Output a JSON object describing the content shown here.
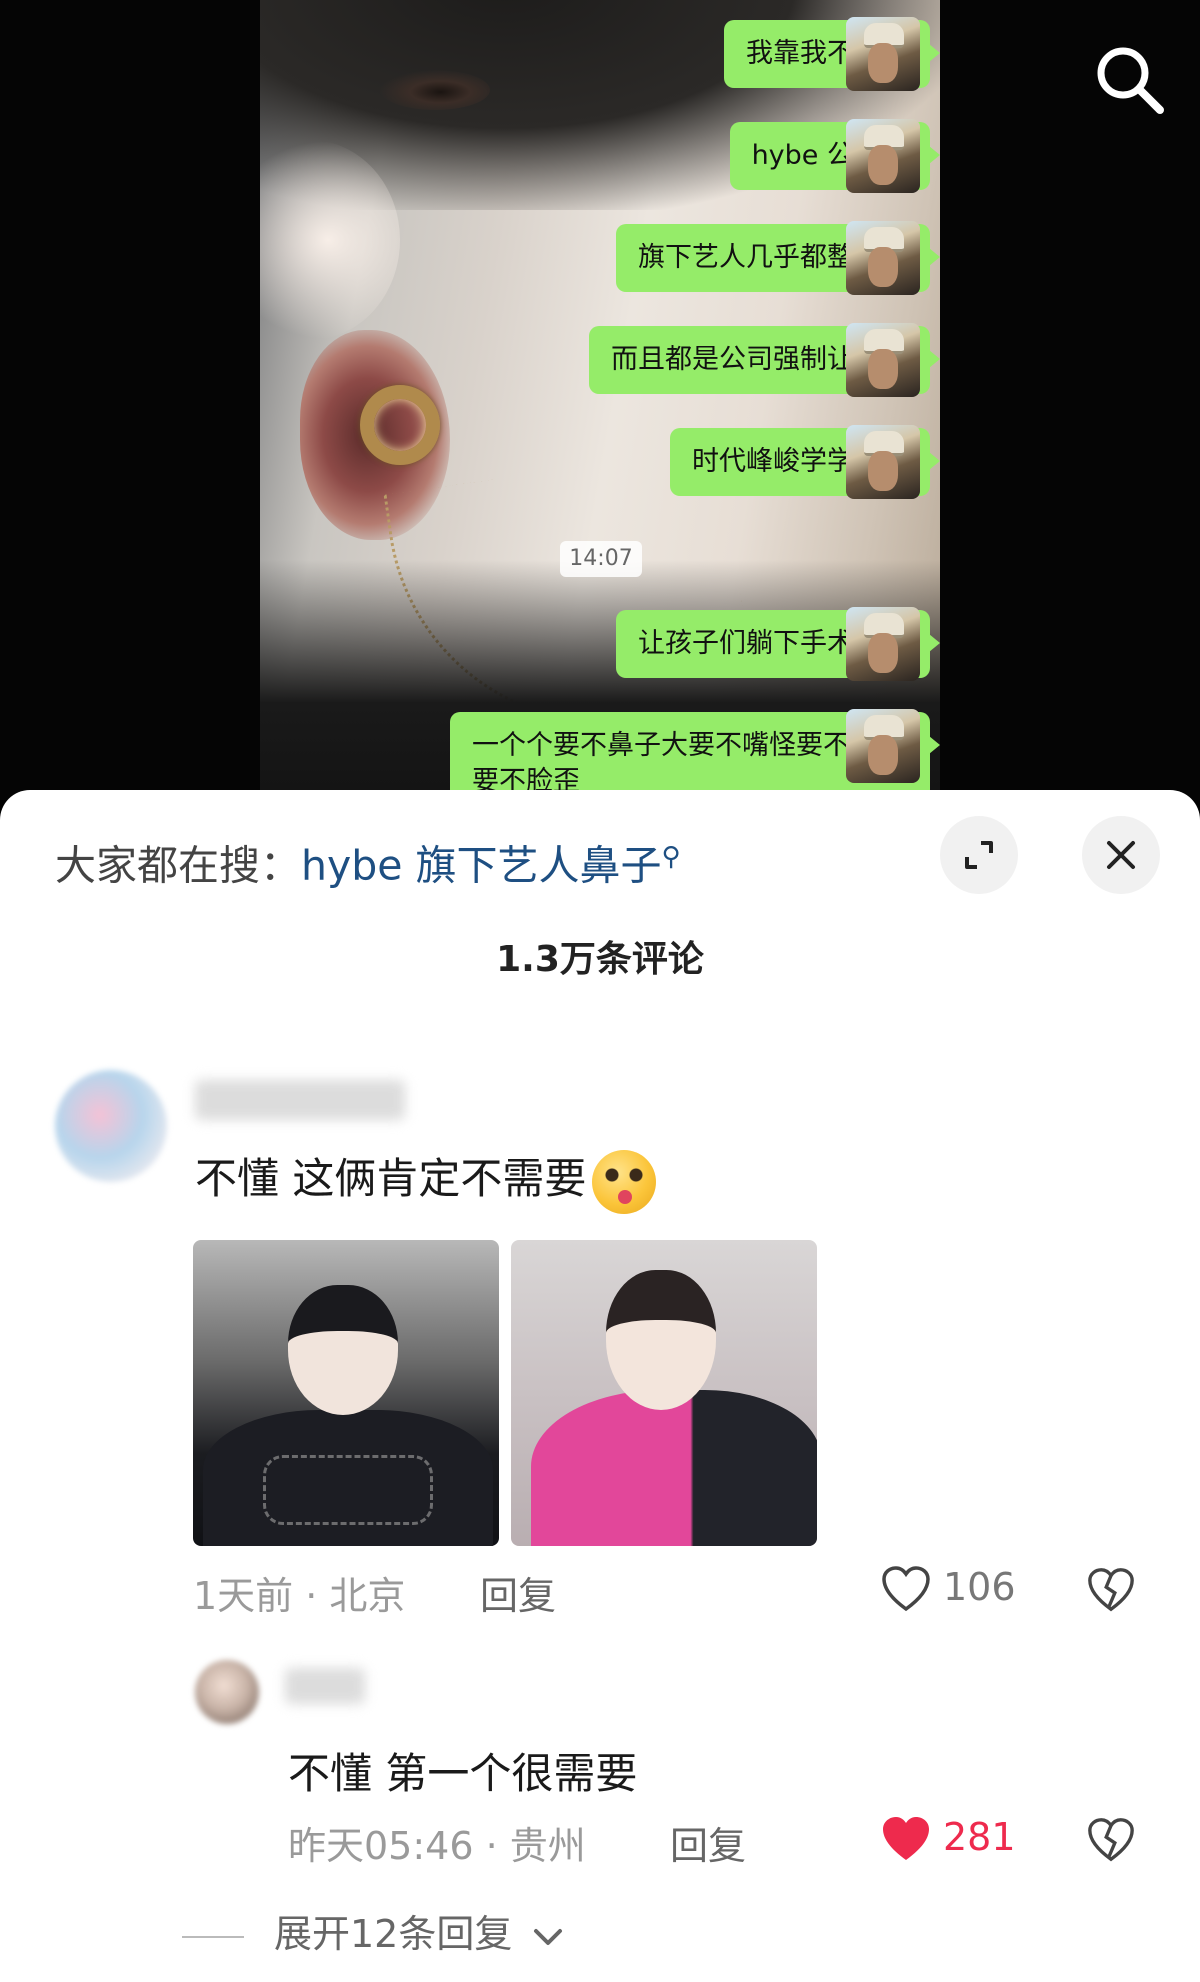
{
  "chat": {
    "messages": [
      "我靠我不行了",
      "hybe 公司的",
      "旗下艺人几乎都整过容",
      "而且都是公司强制让整的",
      "时代峰峻学学吧。",
      "让孩子们躺下手术台吧",
      "一个个要不鼻子大要不嘴怪要不眼小要不脸歪"
    ],
    "timestamp": "14:07"
  },
  "panel": {
    "search_prefix": "大家都在搜：",
    "search_query": "hybe 旗下艺人鼻子",
    "comment_count": "1.3万条评论"
  },
  "comments": [
    {
      "text": "不懂 这俩肯定不需要",
      "time": "1天前 · 北京",
      "reply_label": "回复",
      "likes": "106"
    },
    {
      "text": "不懂 第一个很需要",
      "time": "昨天05:46 · 贵州",
      "reply_label": "回复",
      "likes": "281"
    }
  ],
  "expand_label": "展开12条回复",
  "colors": {
    "bubble": "#95ec69",
    "link": "#1e4f82",
    "liked": "#ee2a4d"
  },
  "icons": {
    "top_search": "search-icon",
    "expand": "expand-icon",
    "close": "close-icon",
    "like": "heart-icon",
    "dislike": "broken-heart-icon"
  }
}
